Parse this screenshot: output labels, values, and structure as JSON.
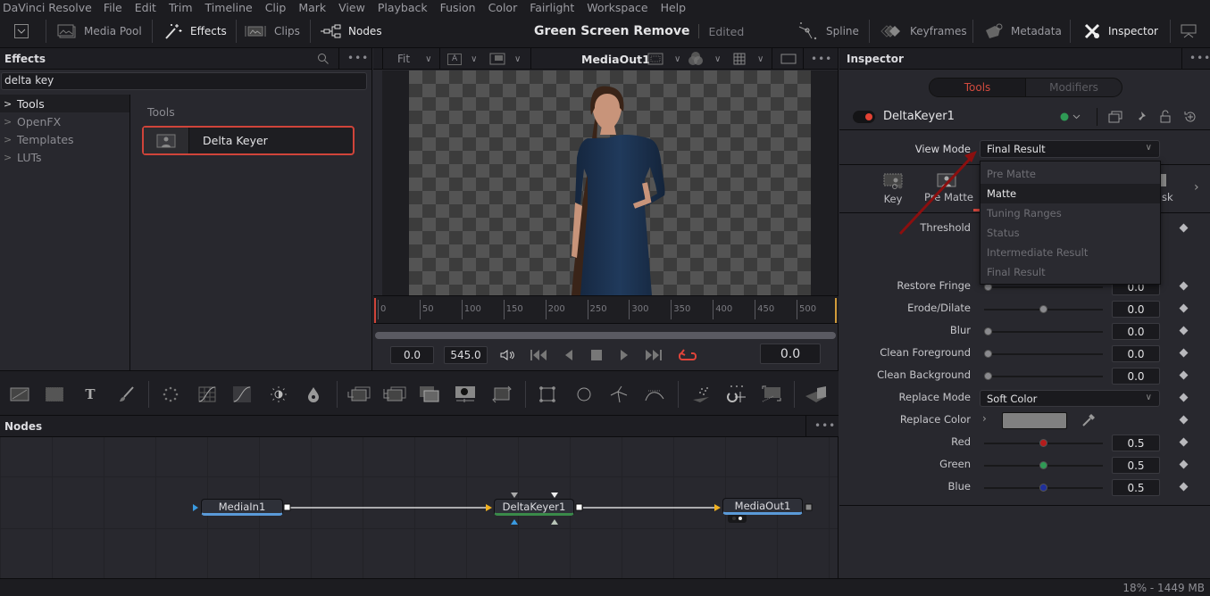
{
  "menu": [
    "DaVinci Resolve",
    "File",
    "Edit",
    "Trim",
    "Timeline",
    "Clip",
    "Mark",
    "View",
    "Playback",
    "Fusion",
    "Color",
    "Fairlight",
    "Workspace",
    "Help"
  ],
  "toolbar": {
    "media_pool": "Media Pool",
    "effects": "Effects",
    "clips": "Clips",
    "nodes": "Nodes",
    "spline": "Spline",
    "keyframes": "Keyframes",
    "metadata": "Metadata",
    "inspector": "Inspector"
  },
  "project": {
    "title": "Green Screen Remove",
    "status": "Edited"
  },
  "effects_panel": {
    "title": "Effects",
    "search_value": "delta key",
    "tree": [
      {
        "label": "Tools",
        "selected": true
      },
      {
        "label": "OpenFX",
        "selected": false
      },
      {
        "label": "Templates",
        "selected": false
      },
      {
        "label": "LUTs",
        "selected": false
      }
    ],
    "section_header": "Tools",
    "result": "Delta Keyer"
  },
  "viewer": {
    "zoom": "Fit",
    "channel": "A",
    "node_name": "MediaOut1",
    "ruler_ticks": [
      "0",
      "50",
      "100",
      "150",
      "200",
      "250",
      "300",
      "350",
      "400",
      "450",
      "500"
    ],
    "render_start": "0.0",
    "render_end": "545.0",
    "current_time": "0.0"
  },
  "nodes_panel": {
    "title": "Nodes",
    "nodes": [
      {
        "name": "MediaIn1"
      },
      {
        "name": "DeltaKeyer1"
      },
      {
        "name": "MediaOut1"
      }
    ]
  },
  "inspector": {
    "title": "Inspector",
    "tabs": [
      {
        "label": "Tools",
        "active": true
      },
      {
        "label": "Modifiers",
        "active": false
      }
    ],
    "tool_name": "DeltaKeyer1",
    "view_mode_label": "View Mode",
    "view_mode_value": "Final Result",
    "view_mode_options": [
      {
        "label": "Pre Matte",
        "highlighted": false
      },
      {
        "label": "Matte",
        "highlighted": true
      },
      {
        "label": "Tuning Ranges",
        "highlighted": false
      },
      {
        "label": "Status",
        "highlighted": false
      },
      {
        "label": "Intermediate Result",
        "highlighted": false
      },
      {
        "label": "Final Result",
        "highlighted": false
      }
    ],
    "sub_tabs": [
      "Key",
      "Pre Matte",
      "Mask"
    ],
    "threshold_label": "Threshold",
    "params": [
      {
        "label": "Restore Fringe",
        "value": "0.0",
        "fraction": 0.0
      },
      {
        "label": "Erode/Dilate",
        "value": "0.0",
        "fraction": 0.5
      },
      {
        "label": "Blur",
        "value": "0.0",
        "fraction": 0.0
      },
      {
        "label": "Clean Foreground",
        "value": "0.0",
        "fraction": 0.0
      },
      {
        "label": "Clean Background",
        "value": "0.0",
        "fraction": 0.0
      }
    ],
    "replace_mode_label": "Replace Mode",
    "replace_mode_value": "Soft Color",
    "replace_color_label": "Replace Color",
    "replace_color_hex": "#808080",
    "color_params": [
      {
        "label": "Red",
        "value": "0.5",
        "fraction": 0.5,
        "color": "#b51c1c"
      },
      {
        "label": "Green",
        "value": "0.5",
        "fraction": 0.5,
        "color": "#2f9a55"
      },
      {
        "label": "Blue",
        "value": "0.5",
        "fraction": 0.5,
        "color": "#1f2f9a"
      }
    ]
  },
  "status_bar": "18% - 1449 MB",
  "colors": {
    "accent": "#d04a3e",
    "highlight_border": "#d0443a",
    "annotation_arrow": "#8b0f0f"
  }
}
